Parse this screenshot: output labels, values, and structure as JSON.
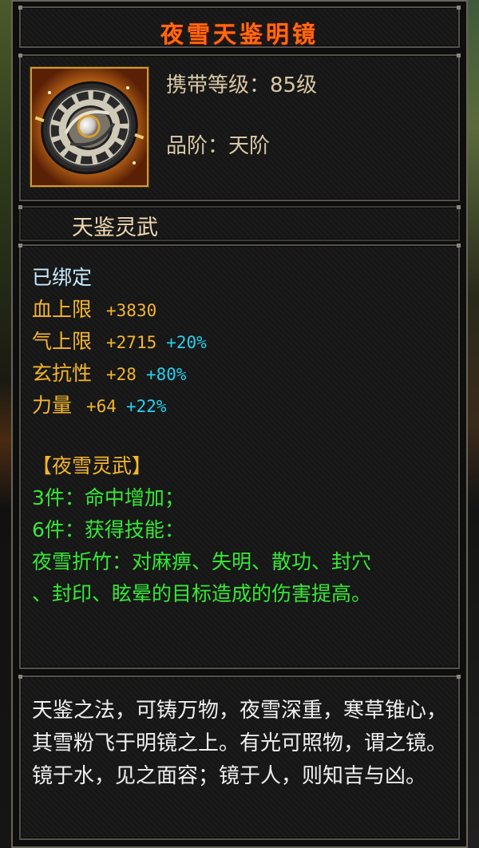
{
  "item": {
    "name": "夜雪天鉴明镜",
    "carry_level": "携带等级：85级",
    "grade": "品阶：天阶",
    "category": "天鉴灵武",
    "icon": "bagua-mirror-icon"
  },
  "attributes": {
    "bound": "已绑定",
    "stats": [
      {
        "name": "血上限",
        "value": "+3830",
        "pct": ""
      },
      {
        "name": "气上限",
        "value": "+2715",
        "pct": "+20%"
      },
      {
        "name": "玄抗性",
        "value": "+28",
        "pct": "+80%"
      },
      {
        "name": "力量",
        "value": "+64",
        "pct": "+22%"
      }
    ]
  },
  "set_bonus": {
    "title": "【夜雪灵武】",
    "piece3": "3件：命中增加；",
    "piece6": "6件：获得技能：",
    "skill_line1": "夜雪折竹：对麻痹、失明、散功、封穴",
    "skill_line2": "、封印、眩晕的目标造成的伤害提高。"
  },
  "description": "天鉴之法，可铸万物，夜雪深重，寒草锥心，其雪粉飞于明镜之上。有光可照物，谓之镜。镜于水，见之面容；镜于人，则知吉与凶。",
  "colors": {
    "title": "#ff6a10",
    "bound": "#c8ecff",
    "stat": "#f5b62a",
    "percent": "#24d2ee",
    "set": "#36e836",
    "frame": "#c89a3a"
  }
}
